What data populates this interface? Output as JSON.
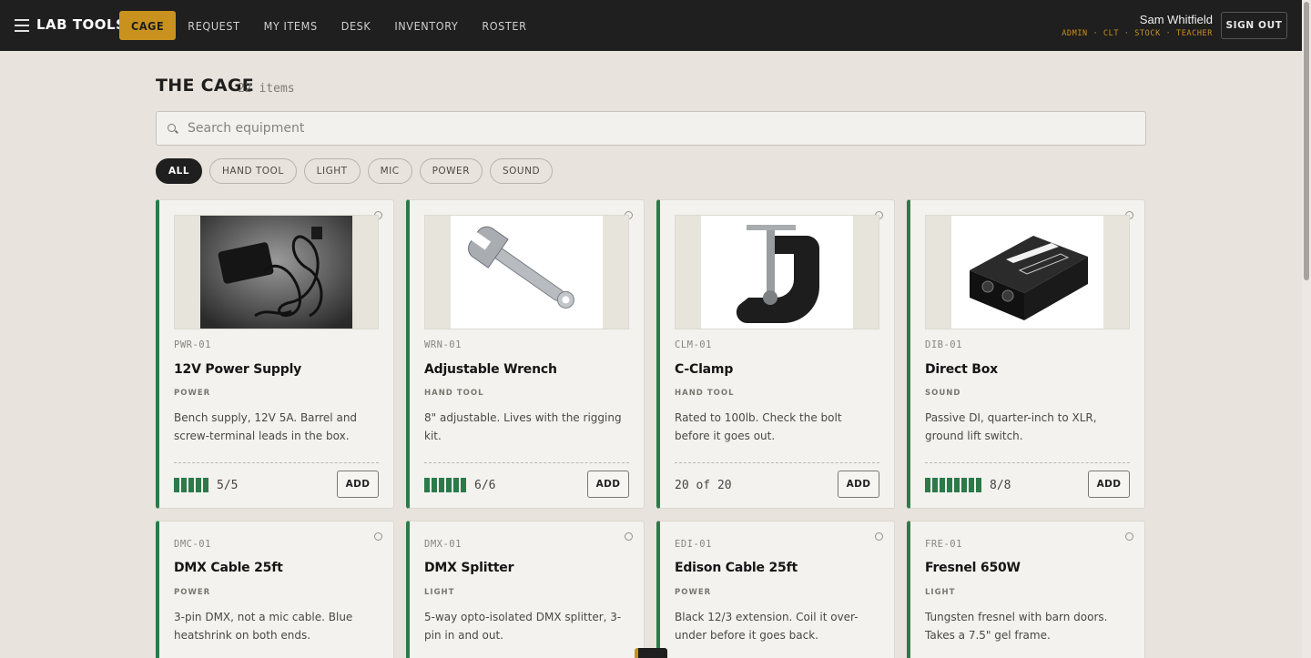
{
  "nav": {
    "brand": "LAB TOOLS",
    "items": [
      {
        "label": "CAGE",
        "active": true
      },
      {
        "label": "REQUEST",
        "active": false
      },
      {
        "label": "MY ITEMS",
        "active": false
      },
      {
        "label": "DESK",
        "active": false
      },
      {
        "label": "INVENTORY",
        "active": false
      },
      {
        "label": "ROSTER",
        "active": false
      }
    ],
    "user_name": "Sam Whitfield",
    "user_roles": "ADMIN · CLT · STOCK · TEACHER",
    "sign_out": "SIGN OUT"
  },
  "header": {
    "title": "THE CAGE",
    "count": "22 items"
  },
  "search": {
    "placeholder": "Search equipment",
    "value": ""
  },
  "filters": [
    "ALL",
    "HAND TOOL",
    "LIGHT",
    "MIC",
    "POWER",
    "SOUND"
  ],
  "active_filter": "ALL",
  "add_label": "ADD",
  "cards": [
    {
      "code": "PWR-01",
      "name": "12V Power Supply",
      "category": "POWER",
      "desc": "Bench supply, 12V 5A. Barrel and screw-terminal leads in the box.",
      "stock_text": "5/5",
      "stock_available": 5,
      "stock_total": 5
    },
    {
      "code": "WRN-01",
      "name": "Adjustable Wrench",
      "category": "HAND TOOL",
      "desc": "8\" adjustable. Lives with the rigging kit.",
      "stock_text": "6/6",
      "stock_available": 6,
      "stock_total": 6
    },
    {
      "code": "CLM-01",
      "name": "C-Clamp",
      "category": "HAND TOOL",
      "desc": "Rated to 100lb. Check the bolt before it goes out.",
      "stock_text": "20 of 20",
      "stock_available": 20,
      "stock_total": 20
    },
    {
      "code": "DIB-01",
      "name": "Direct Box",
      "category": "SOUND",
      "desc": "Passive DI, quarter-inch to XLR, ground lift switch.",
      "stock_text": "8/8",
      "stock_available": 8,
      "stock_total": 8
    },
    {
      "code": "DMC-01",
      "name": "DMX Cable 25ft",
      "category": "POWER",
      "desc": "3-pin DMX, not a mic cable. Blue heatshrink on both ends."
    },
    {
      "code": "DMX-01",
      "name": "DMX Splitter",
      "category": "LIGHT",
      "desc": "5-way opto-isolated DMX splitter, 3-pin in and out."
    },
    {
      "code": "EDI-01",
      "name": "Edison Cable 25ft",
      "category": "POWER",
      "desc": "Black 12/3 extension. Coil it over-under before it goes back."
    },
    {
      "code": "FRE-01",
      "name": "Fresnel 650W",
      "category": "LIGHT",
      "desc": "Tungsten fresnel with barn doors. Takes a 7.5\" gel frame."
    }
  ],
  "colors": {
    "accent": "#c9911e",
    "stock_green": "#2c7a4a",
    "topbar": "#1e1f1e",
    "page_bg": "#e8e3dc"
  }
}
